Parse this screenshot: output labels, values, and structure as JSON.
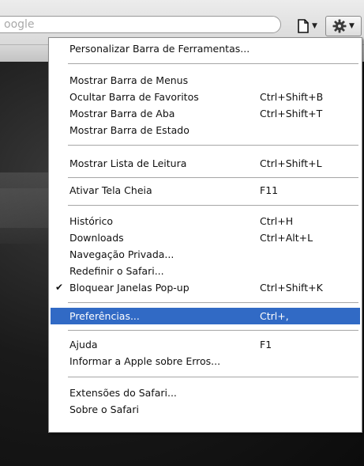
{
  "toolbar": {
    "search_text": "oogle",
    "page_icon": "page-menu-icon",
    "gear_icon": "gear-icon"
  },
  "menu": {
    "items": [
      {
        "label": "Personalizar Barra de Ferramentas...",
        "shortcut": ""
      },
      {
        "label": "Mostrar Barra de Menus",
        "shortcut": ""
      },
      {
        "label": "Ocultar Barra de Favoritos",
        "shortcut": "Ctrl+Shift+B"
      },
      {
        "label": "Mostrar Barra de Aba",
        "shortcut": "Ctrl+Shift+T"
      },
      {
        "label": "Mostrar Barra de Estado",
        "shortcut": ""
      },
      {
        "label": "Mostrar Lista de Leitura",
        "shortcut": "Ctrl+Shift+L"
      },
      {
        "label": "Ativar Tela Cheia",
        "shortcut": "F11"
      },
      {
        "label": "Histórico",
        "shortcut": "Ctrl+H"
      },
      {
        "label": "Downloads",
        "shortcut": "Ctrl+Alt+L"
      },
      {
        "label": "Navegação Privada...",
        "shortcut": ""
      },
      {
        "label": "Redefinir o Safari...",
        "shortcut": ""
      },
      {
        "label": "Bloquear Janelas Pop-up",
        "shortcut": "Ctrl+Shift+K",
        "checked": true,
        "check_mark": "✔"
      },
      {
        "label": "Preferências...",
        "shortcut": "Ctrl+,",
        "selected": true
      },
      {
        "label": "Ajuda",
        "shortcut": "F1"
      },
      {
        "label": "Informar a Apple sobre Erros...",
        "shortcut": ""
      },
      {
        "label": "Extensões do Safari...",
        "shortcut": ""
      },
      {
        "label": "Sobre o Safari",
        "shortcut": ""
      }
    ]
  },
  "colors": {
    "selection": "#316ac5",
    "menu_background": "#ffffff",
    "separator": "#a6a6a6"
  }
}
